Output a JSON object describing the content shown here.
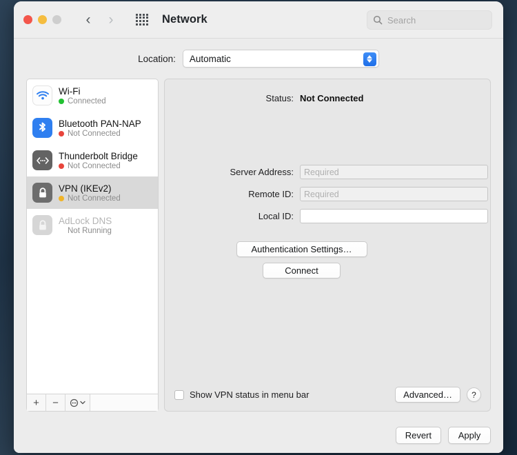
{
  "window": {
    "title": "Network",
    "traffic_lights": [
      "close",
      "minimize",
      "zoom"
    ],
    "back_icon": "chevron-left-icon",
    "forward_icon": "chevron-right-icon",
    "grid_icon": "show-all-grid-icon"
  },
  "search": {
    "placeholder": "Search",
    "icon": "search-icon"
  },
  "location": {
    "label": "Location:",
    "value": "Automatic",
    "options": [
      "Automatic"
    ]
  },
  "sidebar": {
    "services": [
      {
        "name": "Wi-Fi",
        "status": "Connected",
        "status_color": "#22c132",
        "icon": "wifi-icon",
        "selected": false,
        "disabled": false,
        "has_dot": true
      },
      {
        "name": "Bluetooth PAN-NAP",
        "status": "Not Connected",
        "status_color": "#e8453c",
        "icon": "bluetooth-icon",
        "selected": false,
        "disabled": false,
        "has_dot": true
      },
      {
        "name": "Thunderbolt Bridge",
        "status": "Not Connected",
        "status_color": "#e8453c",
        "icon": "thunderbolt-bridge-icon",
        "selected": false,
        "disabled": false,
        "has_dot": true
      },
      {
        "name": "VPN (IKEv2)",
        "status": "Not Connected",
        "status_color": "#f0b429",
        "icon": "lock-icon",
        "selected": true,
        "disabled": false,
        "has_dot": true
      },
      {
        "name": "AdLock DNS",
        "status": "Not Running",
        "status_color": "",
        "icon": "lock-icon",
        "selected": false,
        "disabled": true,
        "has_dot": false
      }
    ],
    "toolbar": {
      "add_label": "+",
      "remove_label": "−",
      "action_icon": "action-menu-icon",
      "action_chevron": "chevron-down-icon"
    }
  },
  "detail": {
    "status_label": "Status:",
    "status_value": "Not Connected",
    "fields": [
      {
        "label": "Server Address:",
        "value": "",
        "placeholder": "Required",
        "shaded": true
      },
      {
        "label": "Remote ID:",
        "value": "",
        "placeholder": "Required",
        "shaded": true
      },
      {
        "label": "Local ID:",
        "value": "",
        "placeholder": "",
        "shaded": false
      }
    ],
    "auth_button": "Authentication Settings…",
    "connect_button": "Connect",
    "checkbox_label": "Show VPN status in menu bar",
    "checkbox_checked": false,
    "advanced_button": "Advanced…",
    "help_button": "?"
  },
  "footer": {
    "revert_button": "Revert",
    "apply_button": "Apply"
  },
  "colors": {
    "accent": "#2f7ff0",
    "connected": "#22c132",
    "not_connected": "#e8453c",
    "pending": "#f0b429"
  }
}
